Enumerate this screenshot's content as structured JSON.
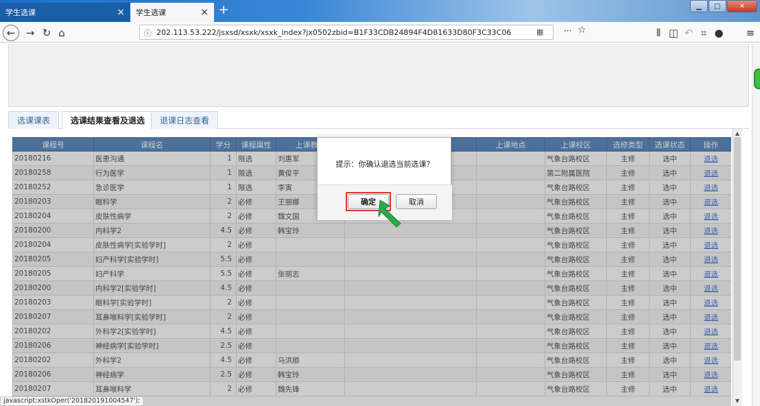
{
  "browser": {
    "tabs": [
      {
        "title": "学生选课",
        "close": "×"
      },
      {
        "title": "学生选课",
        "close": "×"
      }
    ],
    "new_tab": "+",
    "url": "202.113.53.222/jsxsd/xsxk/xsxk_index?jx0502zbid=B1F33CDB24894F4D81633D80F3C33C06",
    "status_text": "javascript:xstkOper('201820191004547');"
  },
  "page_tabs": [
    {
      "label": "选课课表"
    },
    {
      "label": "选课结果查看及退选"
    },
    {
      "label": "退课日志查看"
    }
  ],
  "table": {
    "headers": [
      "课程号",
      "课程名",
      "学分",
      "课程属性",
      "上课教师",
      "",
      "上课地点",
      "上课校区",
      "选修类型",
      "选课状态",
      "操作"
    ],
    "rows": [
      [
        "20180216",
        "医患沟通",
        "1",
        "限选",
        "刘惠军",
        "",
        "",
        "气象台路校区",
        "主修",
        "选中",
        "退选"
      ],
      [
        "20180258",
        "行为医学",
        "1",
        "限选",
        "黄俊平",
        "",
        "",
        "第二附属医院",
        "主修",
        "选中",
        "退选"
      ],
      [
        "20180252",
        "急诊医学",
        "1",
        "限选",
        "李寅",
        "",
        "",
        "气象台路校区",
        "主修",
        "选中",
        "退选"
      ],
      [
        "20180203",
        "眼科学",
        "2",
        "必修",
        "王丽娜",
        "",
        "",
        "气象台路校区",
        "主修",
        "选中",
        "退选"
      ],
      [
        "20180204",
        "皮肤性病学",
        "2",
        "必修",
        "魏文国",
        "",
        "",
        "气象台路校区",
        "主修",
        "选中",
        "退选"
      ],
      [
        "20180200",
        "内科学2",
        "4.5",
        "必修",
        "韩宝玲",
        "",
        "",
        "气象台路校区",
        "主修",
        "选中",
        "退选"
      ],
      [
        "20180204",
        "皮肤性病学[实验学时]",
        "2",
        "必修",
        "",
        "",
        "",
        "气象台路校区",
        "主修",
        "选中",
        "退选"
      ],
      [
        "20180205",
        "妇产科学[实验学时]",
        "5.5",
        "必修",
        "",
        "",
        "",
        "气象台路校区",
        "主修",
        "选中",
        "退选"
      ],
      [
        "20180205",
        "妇产科学",
        "5.5",
        "必修",
        "张丽志",
        "",
        "",
        "气象台路校区",
        "主修",
        "选中",
        "退选"
      ],
      [
        "20180200",
        "内科学2[实验学时]",
        "4.5",
        "必修",
        "",
        "",
        "",
        "气象台路校区",
        "主修",
        "选中",
        "退选"
      ],
      [
        "20180203",
        "眼科学[实验学时]",
        "2",
        "必修",
        "",
        "",
        "",
        "气象台路校区",
        "主修",
        "选中",
        "退选"
      ],
      [
        "20180207",
        "耳鼻喉科学[实验学时]",
        "2",
        "必修",
        "",
        "",
        "",
        "气象台路校区",
        "主修",
        "选中",
        "退选"
      ],
      [
        "20180202",
        "外科学2[实验学时]",
        "4.5",
        "必修",
        "",
        "",
        "",
        "气象台路校区",
        "主修",
        "选中",
        "退选"
      ],
      [
        "20180206",
        "神经病学[实验学时]",
        "2.5",
        "必修",
        "",
        "",
        "",
        "气象台路校区",
        "主修",
        "选中",
        "退选"
      ],
      [
        "20180202",
        "外科学2",
        "4.5",
        "必修",
        "马洪顺",
        "",
        "",
        "气象台路校区",
        "主修",
        "选中",
        "退选"
      ],
      [
        "20180206",
        "神经病学",
        "2.5",
        "必修",
        "韩宝玲",
        "",
        "",
        "气象台路校区",
        "主修",
        "选中",
        "退选"
      ],
      [
        "20180207",
        "耳鼻喉科学",
        "2",
        "必修",
        "魏先锋",
        "",
        "",
        "气象台路校区",
        "主修",
        "选中",
        "退选"
      ]
    ]
  },
  "dialog": {
    "message": "提示：你确认退选当前选课？",
    "ok_label": "确定",
    "cancel_label": "取消"
  }
}
